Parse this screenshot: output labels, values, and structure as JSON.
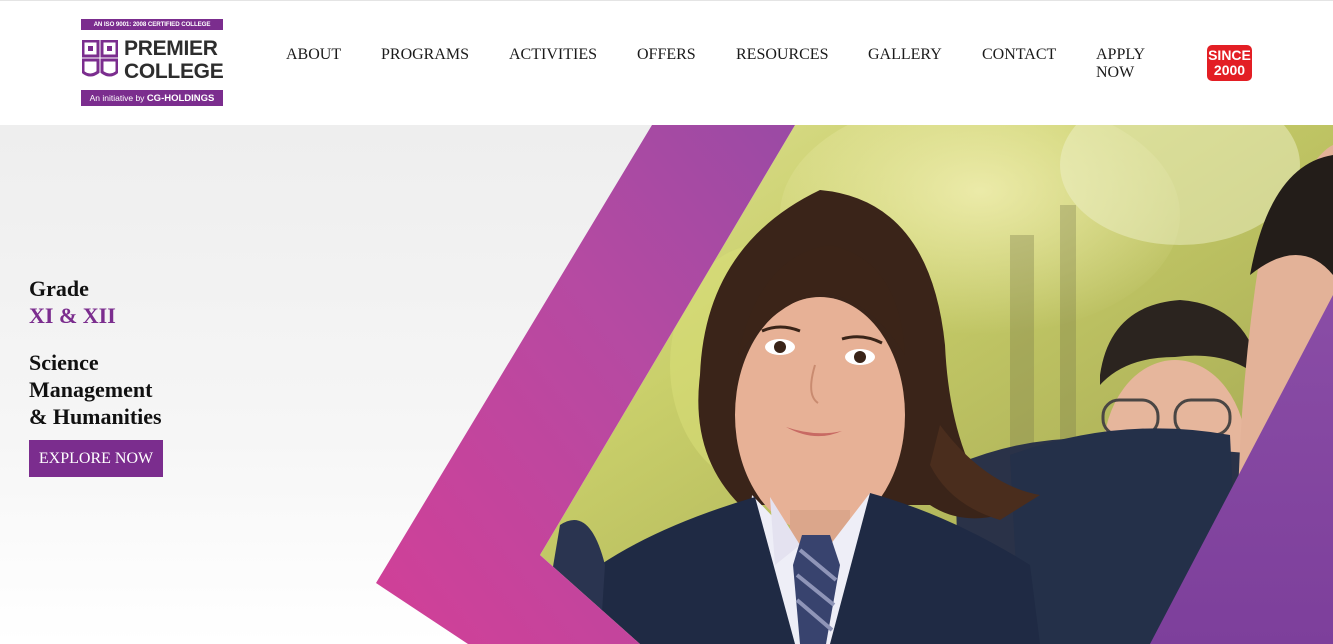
{
  "logo": {
    "certification": "AN ISO 9001: 2008 CERTIFIED COLLEGE",
    "name_line1": "PREMIER",
    "name_line2": "COLLEGE",
    "initiative_prefix": "An initiative by",
    "initiative_org": "CG-HOLDINGS"
  },
  "nav": {
    "items": [
      {
        "label": "ABOUT"
      },
      {
        "label": "PROGRAMS"
      },
      {
        "label": "ACTIVITIES"
      },
      {
        "label": "OFFERS"
      },
      {
        "label": "RESOURCES"
      },
      {
        "label": "GALLERY"
      },
      {
        "label": "CONTACT"
      },
      {
        "label": "APPLY NOW"
      }
    ]
  },
  "badge": {
    "line1": "SINCE",
    "line2": "2000"
  },
  "hero": {
    "grade_label": "Grade",
    "grade_level": "XI & XII",
    "streams": [
      "Science",
      "Management",
      "& Humanities"
    ],
    "cta_label": "EXPLORE NOW"
  },
  "colors": {
    "brand_purple": "#7b2d8e",
    "accent_magenta": "#c53c9a",
    "badge_red": "#e31e24"
  }
}
